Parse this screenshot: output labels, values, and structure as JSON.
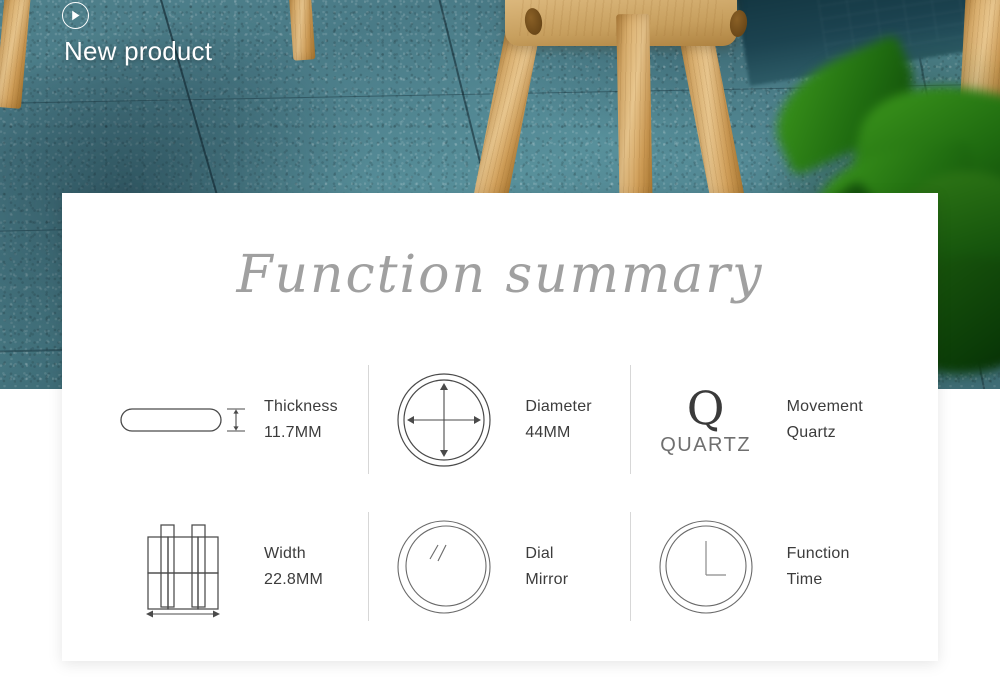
{
  "hero": {
    "badge_icon": "play-circle-icon",
    "title_line1": "New",
    "title_line2": "product",
    "title_text": "New\nproduct"
  },
  "card": {
    "title": "Function summary",
    "specs": [
      {
        "id": "thickness",
        "icon": "watch-case-side-profile-icon",
        "label": "Thickness",
        "value": "11.7MM"
      },
      {
        "id": "diameter",
        "icon": "circle-four-way-arrow-icon",
        "label": "Diameter",
        "value": "44MM"
      },
      {
        "id": "movement",
        "icon": "quartz-q-icon",
        "icon_letter": "Q",
        "icon_word": "QUARTZ",
        "label": "Movement",
        "value": "Quartz"
      },
      {
        "id": "dial",
        "icon": "watch-lugs-width-icon",
        "label": "Width",
        "value": "22.8MM"
      },
      {
        "id": "mirror",
        "icon": "mirror-glint-circle-icon",
        "label": "Dial",
        "value": "Mirror"
      },
      {
        "id": "function",
        "icon": "clock-face-icon",
        "label": "Function",
        "value": "Time"
      }
    ]
  },
  "colors": {
    "card_background": "#ffffff",
    "title_gray": "#a0a0a0",
    "text_dark": "#3c3c3c",
    "divider": "#d7d7d7",
    "hero_teal": "#4c7782",
    "wood": "#d9ae6d",
    "plant_green": "#2e7415",
    "overlay_text": "#ffffff"
  }
}
